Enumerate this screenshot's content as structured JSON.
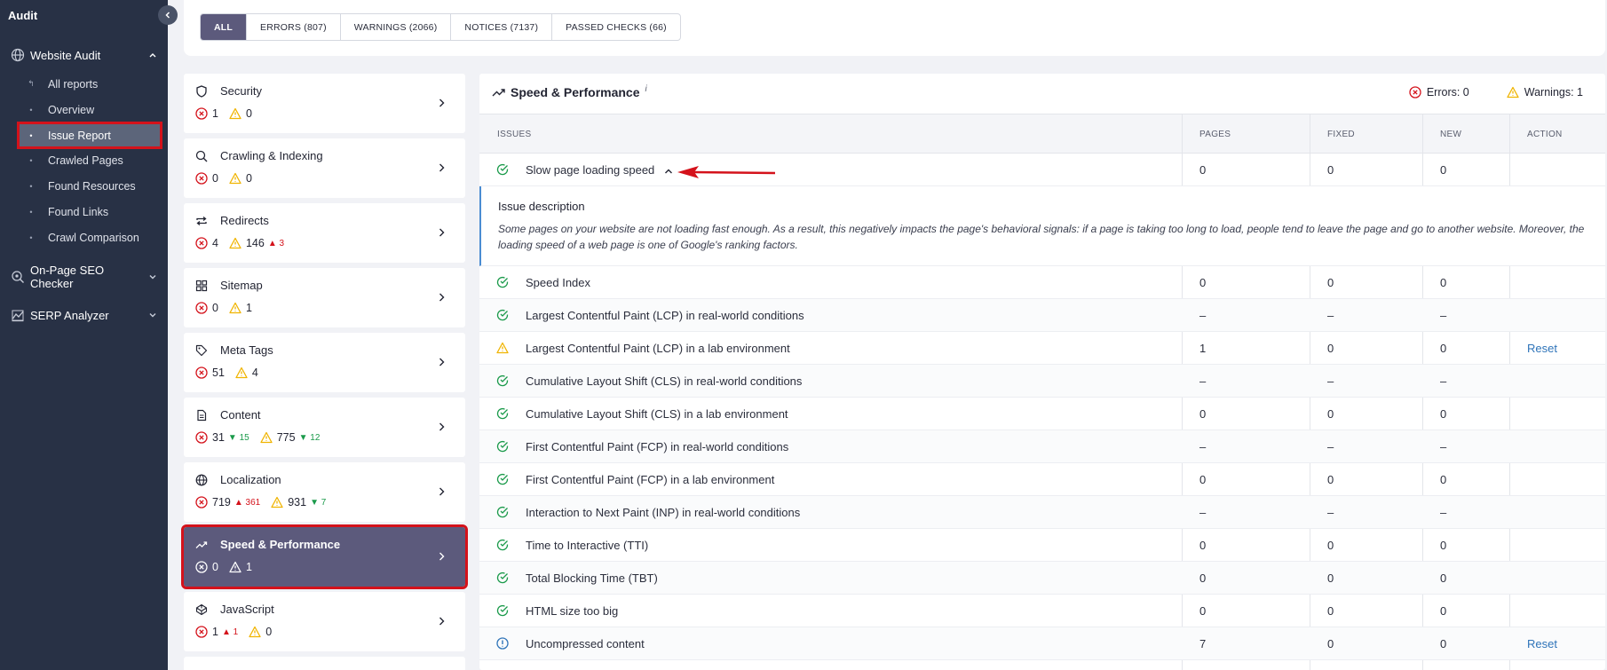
{
  "sidebar": {
    "title": "Audit",
    "sections": [
      {
        "label": "Website Audit",
        "icon": "globe-icon"
      },
      {
        "label": "On-Page SEO Checker",
        "icon": "search-globe-icon"
      },
      {
        "label": "SERP Analyzer",
        "icon": "chart-icon"
      }
    ],
    "items": [
      {
        "label": "All reports",
        "bullet": "↰"
      },
      {
        "label": "Overview",
        "bullet": "•"
      },
      {
        "label": "Issue Report",
        "bullet": "•"
      },
      {
        "label": "Crawled Pages",
        "bullet": "•"
      },
      {
        "label": "Found Resources",
        "bullet": "•"
      },
      {
        "label": "Found Links",
        "bullet": "•"
      },
      {
        "label": "Crawl Comparison",
        "bullet": "•"
      }
    ],
    "active_item": "Issue Report"
  },
  "filters": {
    "tabs": [
      "ALL",
      "ERRORS (807)",
      "WARNINGS (2066)",
      "NOTICES (7137)",
      "PASSED CHECKS (66)"
    ],
    "active": "ALL"
  },
  "categories": [
    {
      "name": "Security",
      "icon": "shield-icon",
      "errors": "1",
      "warnings": "0"
    },
    {
      "name": "Crawling & Indexing",
      "icon": "search-icon",
      "errors": "0",
      "warnings": "0"
    },
    {
      "name": "Redirects",
      "icon": "redirect-icon",
      "errors": "4",
      "warnings": "146",
      "warnings_up": "3"
    },
    {
      "name": "Sitemap",
      "icon": "grid-icon",
      "errors": "0",
      "warnings": "1"
    },
    {
      "name": "Meta Tags",
      "icon": "tag-icon",
      "errors": "51",
      "warnings": "4"
    },
    {
      "name": "Content",
      "icon": "document-icon",
      "errors": "31",
      "errors_down": "15",
      "warnings": "775",
      "warnings_down": "12"
    },
    {
      "name": "Localization",
      "icon": "globe-icon",
      "errors": "719",
      "errors_up": "361",
      "warnings": "931",
      "warnings_down": "7"
    },
    {
      "name": "Speed & Performance",
      "icon": "trend-icon",
      "errors": "0",
      "warnings": "1"
    },
    {
      "name": "JavaScript",
      "icon": "codepen-icon",
      "errors": "1",
      "errors_up": "1",
      "warnings": "0"
    }
  ],
  "panel": {
    "title": "Speed & Performance",
    "info": "i",
    "errors_label": "Errors: 0",
    "warnings_label": "Warnings: 1",
    "columns": [
      "ISSUES",
      "PAGES",
      "FIXED",
      "NEW",
      "ACTION"
    ],
    "description_title": "Issue description",
    "description_text": "Some pages on your website are not loading fast enough. As a result, this negatively impacts the page's behavioral signals: if a page is taking too long to load, people tend to leave the page and go to another website. Moreover, the loading speed of a web page is one of Google's ranking factors.",
    "rows": [
      {
        "status": "passed",
        "name": "Slow page loading speed",
        "pages": "0",
        "fixed": "0",
        "new": "0",
        "action": ""
      },
      {
        "status": "passed",
        "name": "Speed Index",
        "pages": "0",
        "fixed": "0",
        "new": "0",
        "action": ""
      },
      {
        "status": "passed",
        "name": "Largest Contentful Paint (LCP) in real-world conditions",
        "pages": "–",
        "fixed": "–",
        "new": "–",
        "action": ""
      },
      {
        "status": "warning",
        "name": "Largest Contentful Paint (LCP) in a lab environment",
        "pages": "1",
        "fixed": "0",
        "new": "0",
        "action": "Reset"
      },
      {
        "status": "passed",
        "name": "Cumulative Layout Shift (CLS) in real-world conditions",
        "pages": "–",
        "fixed": "–",
        "new": "–",
        "action": ""
      },
      {
        "status": "passed",
        "name": "Cumulative Layout Shift (CLS) in a lab environment",
        "pages": "0",
        "fixed": "0",
        "new": "0",
        "action": ""
      },
      {
        "status": "passed",
        "name": "First Contentful Paint (FCP) in real-world conditions",
        "pages": "–",
        "fixed": "–",
        "new": "–",
        "action": ""
      },
      {
        "status": "passed",
        "name": "First Contentful Paint (FCP) in a lab environment",
        "pages": "0",
        "fixed": "0",
        "new": "0",
        "action": ""
      },
      {
        "status": "passed",
        "name": "Interaction to Next Paint (INP) in real-world conditions",
        "pages": "–",
        "fixed": "–",
        "new": "–",
        "action": ""
      },
      {
        "status": "passed",
        "name": "Time to Interactive (TTI)",
        "pages": "0",
        "fixed": "0",
        "new": "0",
        "action": ""
      },
      {
        "status": "passed",
        "name": "Total Blocking Time (TBT)",
        "pages": "0",
        "fixed": "0",
        "new": "0",
        "action": ""
      },
      {
        "status": "passed",
        "name": "HTML size too big",
        "pages": "0",
        "fixed": "0",
        "new": "0",
        "action": ""
      },
      {
        "status": "notice",
        "name": "Uncompressed content",
        "pages": "7",
        "fixed": "0",
        "new": "0",
        "action": "Reset"
      }
    ]
  },
  "colors": {
    "sidebar": "#283145",
    "accent": "#5c5a7c",
    "highlight": "#d4121b",
    "error": "#d4121b",
    "warning": "#f0b400",
    "passed": "#1a9a4a",
    "notice": "#2f74b9",
    "link": "#2f74b9"
  }
}
